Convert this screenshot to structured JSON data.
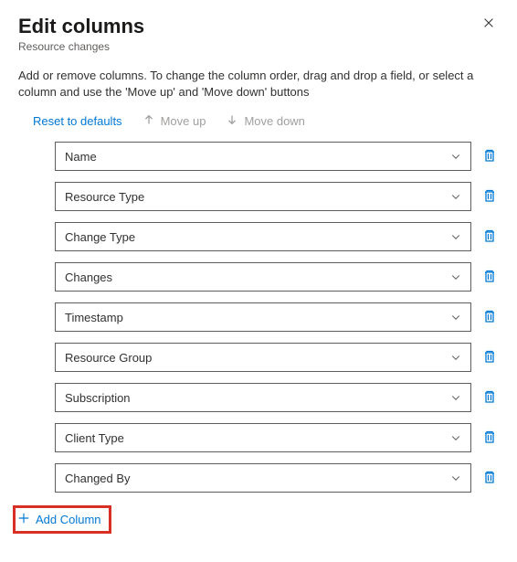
{
  "header": {
    "title": "Edit columns",
    "subtitle": "Resource changes"
  },
  "description": "Add or remove columns. To change the column order, drag and drop a field, or select a column and use the 'Move up' and 'Move down' buttons",
  "actions": {
    "reset": "Reset to defaults",
    "moveUp": "Move up",
    "moveDown": "Move down"
  },
  "columns": [
    {
      "label": "Name"
    },
    {
      "label": "Resource Type"
    },
    {
      "label": "Change Type"
    },
    {
      "label": "Changes"
    },
    {
      "label": "Timestamp"
    },
    {
      "label": "Resource Group"
    },
    {
      "label": "Subscription"
    },
    {
      "label": "Client Type"
    },
    {
      "label": "Changed By"
    }
  ],
  "addColumn": "Add Column",
  "colors": {
    "accent": "#0078d4",
    "highlight": "#d93025"
  }
}
